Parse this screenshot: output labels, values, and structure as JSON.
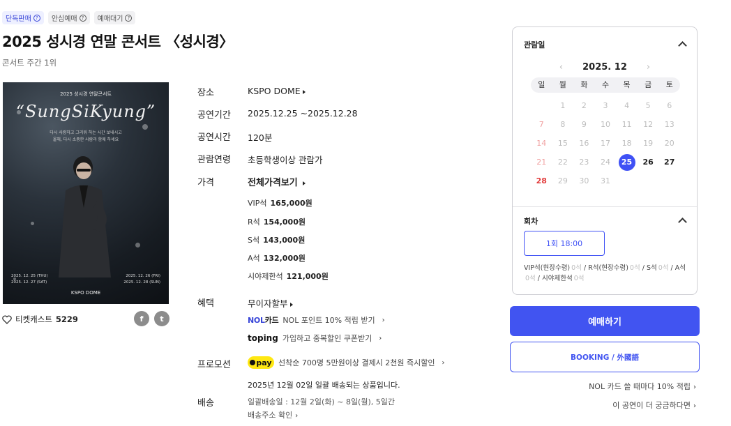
{
  "badges": [
    {
      "label": "단독판매"
    },
    {
      "label": "안심예매"
    },
    {
      "label": "예매대기"
    }
  ],
  "title": "2025 성시경 연말 콘서트 〈성시경〉",
  "rank_text": "콘서트 주간 1위",
  "poster": {
    "top_text": "2025 성시경 연말콘서트",
    "script_text": "“SungSiKyung”",
    "desc_lines": [
      "다시 사랑하고 그리워 하는 시간 보내시고",
      "올해, 다시 소중한 사람과 함께 하세요"
    ],
    "dates_left": [
      "2025. 12. 25 (THU)",
      "2025. 12. 27 (SAT)"
    ],
    "dates_right": [
      "2025. 12. 26 (FRI)",
      "2025. 12. 28 (SUN)"
    ],
    "venue": "KSPO DOME"
  },
  "favorites": {
    "label": "티켓캐스트",
    "count": "5229"
  },
  "share": {
    "facebook": "f",
    "twitter": "t"
  },
  "info": {
    "venue_label": "장소",
    "venue": "KSPO DOME",
    "period_label": "공연기간",
    "period": "2025.12.25 ~2025.12.28",
    "runtime_label": "공연시간",
    "runtime": "120분",
    "age_label": "관람연령",
    "age": "초등학생이상 관람가",
    "price_label": "가격",
    "price_all": "전체가격보기",
    "prices": [
      {
        "grade": "VIP석",
        "amount": "165,000원"
      },
      {
        "grade": "R석",
        "amount": "154,000원"
      },
      {
        "grade": "S석",
        "amount": "143,000원"
      },
      {
        "grade": "A석",
        "amount": "132,000원"
      },
      {
        "grade": "시야제한석",
        "amount": "121,000원"
      }
    ],
    "benefit_label": "혜택",
    "benefit_main": "무이자할부",
    "nol_logo_a": "NOL",
    "nol_logo_b": "카드",
    "nol_text": "NOL 포인트 10% 적립 받기",
    "toping_logo": "toping",
    "toping_text": "가입하고 중복할인 쿠폰받기",
    "promo_label": "프로모션",
    "pay_logo": "pay",
    "promo_text": "선착순 700명 5만원이상 결제시 2천원 즉시할인",
    "delivery_notice": "2025년 12월 02일 일괄 배송되는 상품입니다.",
    "delivery_label": "배송",
    "delivery_date": "일괄배송일 : 12월 2일(화) ~ 8일(월), 5일간",
    "delivery_address": "배송주소 확인"
  },
  "calendar": {
    "section_title": "관람일",
    "month": "2025. 12",
    "weekdays": [
      "일",
      "월",
      "화",
      "수",
      "목",
      "금",
      "토"
    ],
    "selected_day": "25"
  },
  "session": {
    "section_title": "회차",
    "option": "1회 18:00",
    "seats": [
      {
        "grade": "VIP석(현장수령)",
        "count": "0석"
      },
      {
        "grade": "R석(현장수령)",
        "count": "0석"
      },
      {
        "grade": "S석",
        "count": "0석"
      },
      {
        "grade": "A석",
        "count": "0석"
      },
      {
        "grade": "시야제한석",
        "count": "0석"
      }
    ]
  },
  "actions": {
    "book": "예매하기",
    "book_en": "BOOKING / 外國語",
    "nol_card_link": "NOL 카드 쓸 때마다 10% 적립",
    "curious_link": "이 공연이 더 궁금하다면"
  },
  "colors": {
    "accent": "#4154f1",
    "sunday": "#e23c3c",
    "kakaopay": "#ffe812"
  }
}
